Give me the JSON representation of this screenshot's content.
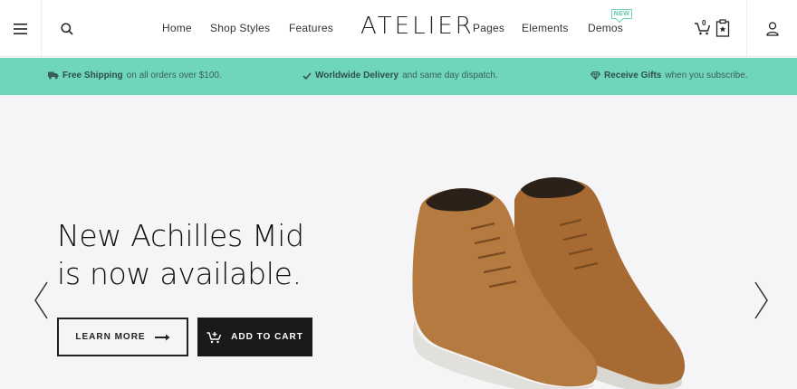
{
  "header": {
    "logo": "ATELIER",
    "nav": {
      "home": "Home",
      "shop_styles": "Shop Styles",
      "features": "Features",
      "pages": "Pages",
      "elements": "Elements",
      "demos": "Demos"
    },
    "demos_badge": "NEW",
    "cart_count": "0",
    "icons": [
      "hamburger-menu-icon",
      "search-icon",
      "cart-icon",
      "wishlist-icon",
      "user-icon"
    ]
  },
  "promo": {
    "shipping_bold": "Free Shipping",
    "shipping_rest": "on all orders over $100.",
    "delivery_bold": "Worldwide Delivery",
    "delivery_rest": "and same day dispatch.",
    "gifts_bold": "Receive Gifts",
    "gifts_rest": "when you subscribe.",
    "icons": [
      "truck-icon",
      "check-icon",
      "diamond-icon"
    ]
  },
  "hero": {
    "headline_line1": "New Achilles Mid",
    "headline_line2": "is now available.",
    "learn_more": "LEARN MORE",
    "add_to_cart": "ADD TO CART"
  },
  "colors": {
    "promo_bg": "#6fd6bd",
    "hero_bg": "#f5f5f7",
    "button_dark": "#1a1a1a",
    "badge": "#5cc7ab",
    "shoe": "#b0733a"
  }
}
